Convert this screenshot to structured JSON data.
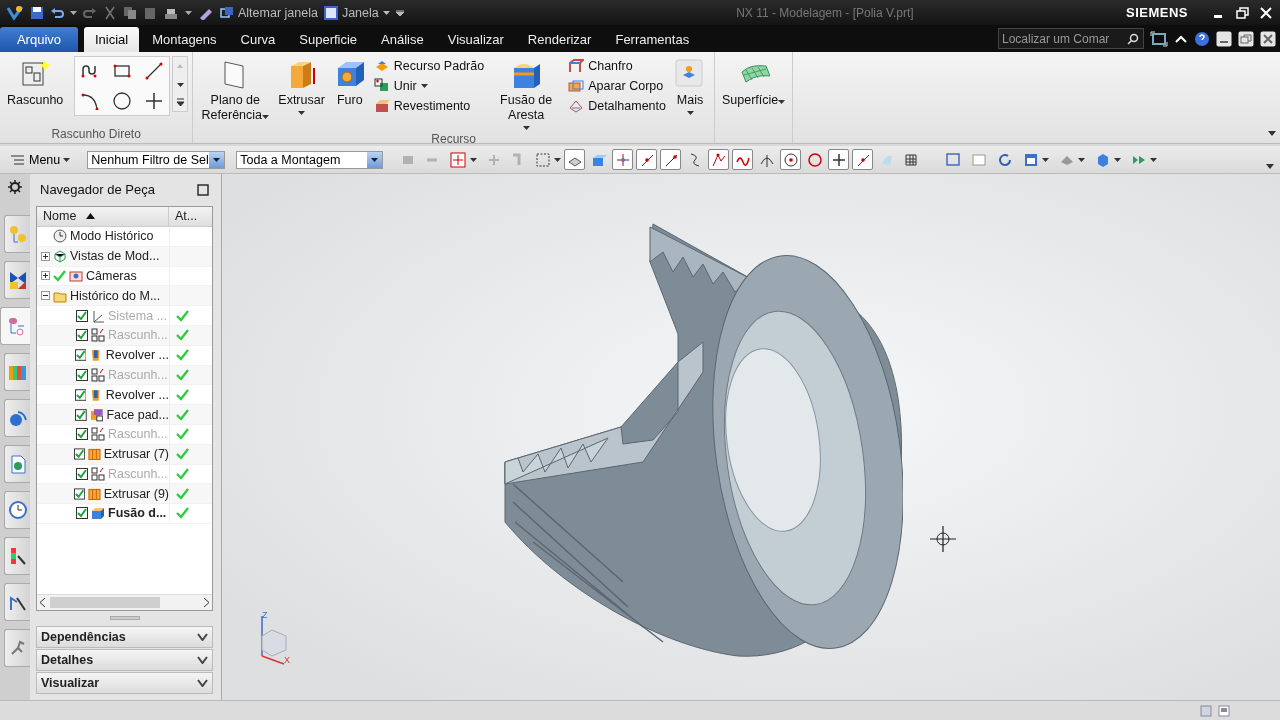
{
  "title_bar": {
    "quick_access": [
      {
        "label": "Altemar janela",
        "dropdown": false
      },
      {
        "label": "Janela",
        "dropdown": true
      }
    ],
    "title": "NX 11 - Modelagem - [Polia V.prt]",
    "brand": "SIEMENS"
  },
  "tabs": [
    {
      "label": "Arquivo",
      "kind": "file",
      "selected": false
    },
    {
      "label": "Inicial",
      "kind": "tab",
      "selected": true
    },
    {
      "label": "Montagens",
      "kind": "tab",
      "selected": false
    },
    {
      "label": "Curva",
      "kind": "tab",
      "selected": false
    },
    {
      "label": "Superficie",
      "kind": "tab",
      "selected": false
    },
    {
      "label": "Análise",
      "kind": "tab",
      "selected": false
    },
    {
      "label": "Visualizar",
      "kind": "tab",
      "selected": false
    },
    {
      "label": "Renderizar",
      "kind": "tab",
      "selected": false
    },
    {
      "label": "Ferramentas",
      "kind": "tab",
      "selected": false
    }
  ],
  "command_search": {
    "placeholder": "Localizar um Comar"
  },
  "ribbon": {
    "groups": [
      {
        "title": "Rascunho Direto",
        "items": [
          {
            "kind": "large",
            "label": "Rascunho",
            "dropdown": false
          },
          {
            "kind": "gallery"
          }
        ]
      },
      {
        "title": "Recurso",
        "items": [
          {
            "kind": "large",
            "label": "Plano de Referência",
            "dropdown": true
          },
          {
            "kind": "large",
            "label": "Extrusar",
            "dropdown": true
          },
          {
            "kind": "large",
            "label": "Furo",
            "dropdown": false
          },
          {
            "kind": "stack",
            "buttons": [
              {
                "label": "Recurso Padrão",
                "dropdown": false
              },
              {
                "label": "Unir",
                "dropdown": true
              },
              {
                "label": "Revestimento",
                "dropdown": false
              }
            ]
          },
          {
            "kind": "large",
            "label": "Fusão de Aresta",
            "dropdown": true
          },
          {
            "kind": "stack",
            "buttons": [
              {
                "label": "Chanfro",
                "dropdown": false
              },
              {
                "label": "Aparar Corpo",
                "dropdown": false
              },
              {
                "label": "Detalhamento",
                "dropdown": false
              }
            ]
          },
          {
            "kind": "large",
            "label": "Mais",
            "dropdown": true
          }
        ]
      },
      {
        "items": [
          {
            "kind": "large",
            "label": "Superfície",
            "dropdown": true
          }
        ]
      }
    ]
  },
  "toolbar": {
    "menu": "Menu",
    "selection_filter": "Nenhum Filtro de Sel",
    "scope": "Toda a Montagem",
    "snap_buttons": [
      {
        "on": true
      },
      {
        "on": false
      },
      {
        "on": true
      },
      {
        "on": true
      },
      {
        "on": true
      },
      {
        "on": false
      },
      {
        "on": true
      },
      {
        "on": true
      },
      {
        "on": false
      },
      {
        "on": true
      },
      {
        "on": false
      },
      {
        "on": true
      },
      {
        "on": true
      },
      {
        "on": false
      },
      {
        "on": false
      }
    ]
  },
  "resource_bar": [
    {
      "selected": false
    },
    {
      "selected": false
    },
    {
      "selected": true
    },
    {
      "selected": false
    },
    {
      "selected": false
    },
    {
      "selected": false
    },
    {
      "selected": false
    },
    {
      "selected": false
    },
    {
      "selected": false
    },
    {
      "selected": false
    }
  ],
  "part_navigator": {
    "title": "Navegador de Peça",
    "columns": [
      {
        "label": "Nome",
        "sorted": true
      },
      {
        "label": "At...",
        "sorted": false
      }
    ],
    "tree": [
      {
        "label": "Modo Histórico",
        "kind": "mode",
        "expanded": false,
        "visible": false
      },
      {
        "label": "Vistas de Mod...",
        "kind": "group",
        "expanded": false,
        "visible": false
      },
      {
        "label": "Câmeras",
        "kind": "group",
        "expanded": false,
        "visible": true
      },
      {
        "label": "Histórico do M...",
        "kind": "group",
        "expanded": true,
        "visible": false,
        "children": [
          {
            "label": "Sistema ...",
            "checked": true,
            "dimmed": true,
            "current": false,
            "up_to_date": true
          },
          {
            "label": "Rascunh...",
            "checked": true,
            "dimmed": true,
            "current": false,
            "up_to_date": true
          },
          {
            "label": "Revolver ...",
            "checked": true,
            "dimmed": false,
            "current": false,
            "up_to_date": true
          },
          {
            "label": "Rascunh...",
            "checked": true,
            "dimmed": true,
            "current": false,
            "up_to_date": true
          },
          {
            "label": "Revolver ...",
            "checked": true,
            "dimmed": false,
            "current": false,
            "up_to_date": true
          },
          {
            "label": "Face pad...",
            "checked": true,
            "dimmed": false,
            "current": false,
            "up_to_date": true
          },
          {
            "label": "Rascunh...",
            "checked": true,
            "dimmed": true,
            "current": false,
            "up_to_date": true
          },
          {
            "label": "Extrusar (7)",
            "checked": true,
            "dimmed": false,
            "current": false,
            "up_to_date": true
          },
          {
            "label": "Rascunh...",
            "checked": true,
            "dimmed": true,
            "current": false,
            "up_to_date": true
          },
          {
            "label": "Extrusar (9)",
            "checked": true,
            "dimmed": false,
            "current": false,
            "up_to_date": true
          },
          {
            "label": "Fusão d...",
            "checked": true,
            "dimmed": false,
            "current": true,
            "up_to_date": true
          }
        ]
      }
    ],
    "panels": [
      {
        "label": "Dependências",
        "expanded": false
      },
      {
        "label": "Detalhes",
        "expanded": false
      },
      {
        "label": "Visualizar",
        "expanded": false
      }
    ]
  },
  "viewport": {
    "triad_labels": [
      "Z",
      "X"
    ]
  }
}
